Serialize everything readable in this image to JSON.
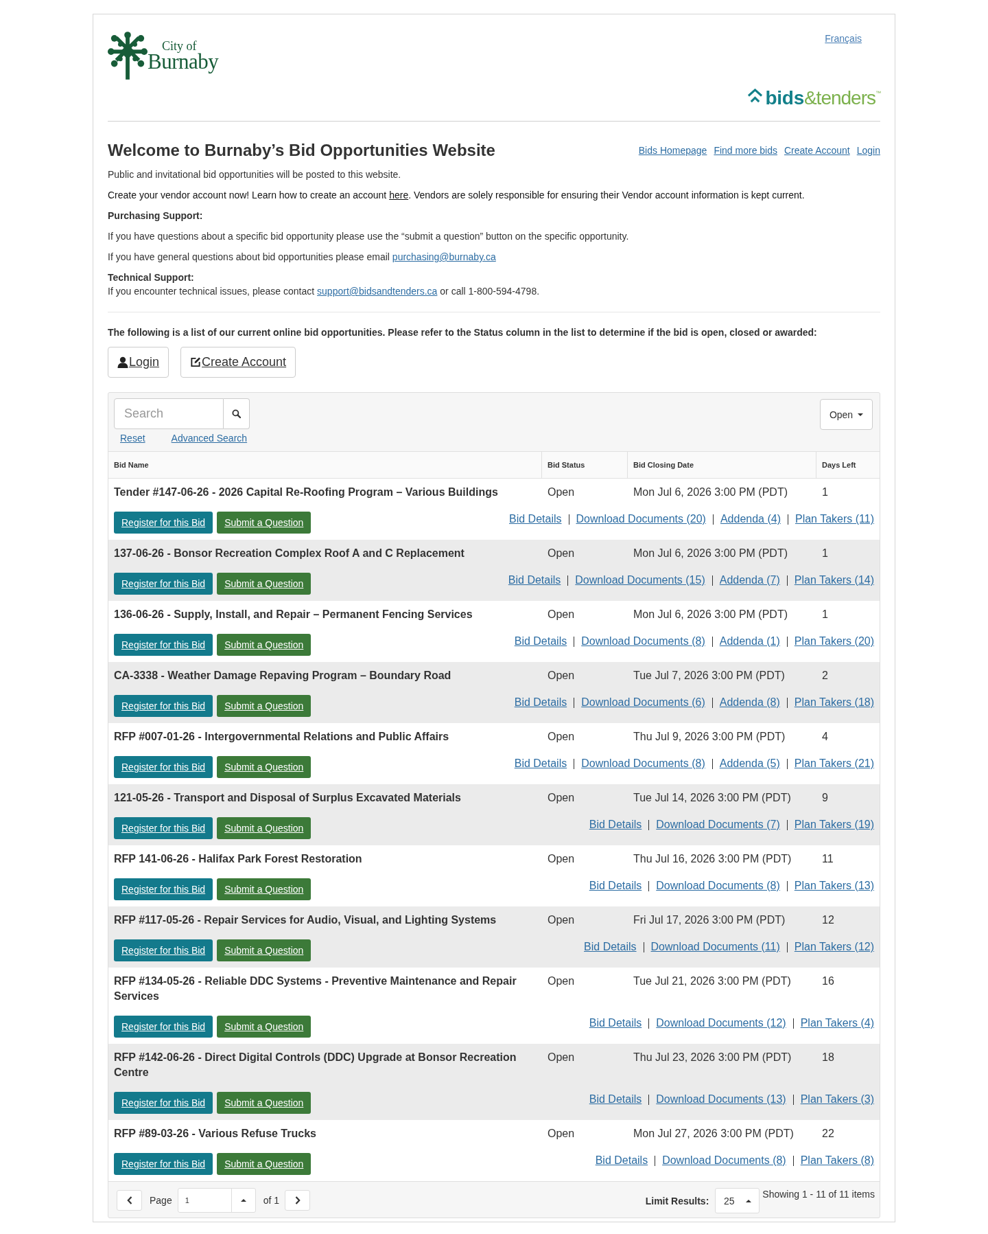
{
  "header": {
    "logo": {
      "line_1": "City of",
      "line_2": "Burnaby"
    },
    "language_link": "Français",
    "brand": "**bids**&tenders$^{™}$"
  },
  "intro": {
    "title": "Welcome to Burnaby’s Bid Opportunities Website",
    "nav_links": [
      "Bids Homepage",
      "Find more bids",
      "Create Account",
      "Login"
    ],
    "subtitle": "Public and invitational bid opportunities will be posted to this website.",
    "account_note": {
      "before": "Create your vendor account now! Learn how to create an account ",
      "link": "here",
      "after": ". Vendors are solely responsible for ensuring their Vendor account information is kept current."
    },
    "purchasing_support": {
      "heading": "Purchasing Support:",
      "lines": [
        {
          "text": "If you have questions about a specific bid opportunity please use the “submit a question” button on the specific opportunity."
        },
        {
          "text": "If you have general questions about bid opportunities please email ",
          "link": "purchasing@burnaby.ca"
        }
      ]
    },
    "technical_support": {
      "heading": "Technical Support:",
      "lines": [
        {
          "text": "If you encounter technical issues, please contact ",
          "link": "support@bidsandtenders.ca",
          "after": " or call 1-800-594-4798."
        }
      ]
    }
  },
  "list_intro": "The following is a list of our current online bid opportunities. Please refer to the Status column in the list to determine if the bid is open, closed or awarded:",
  "account_buttons": [
    {
      "kind": "login",
      "label": "Login"
    },
    {
      "kind": "create",
      "label": "Create Account"
    }
  ],
  "bid_list": {
    "search": {
      "placeholder": "Search"
    },
    "search_links": [
      "Reset",
      "Advanced Search"
    ],
    "status_filter": "Open",
    "columns": [
      "Bid Name",
      "Bid Status",
      "Bid Closing Date",
      "Days Left"
    ],
    "rows": [
      {
        "name": "Tender #147-06-26 - 2026 Capital Re-Roofing Program – Various Buildings",
        "status": "Open",
        "closing_date": "Mon Jul 6, 2026 3:00 PM (PDT)",
        "days_left": "1",
        "buttons": [
          {
            "kind": "register",
            "label": "Register for this Bid"
          },
          {
            "kind": "question",
            "label": "Submit a Question"
          }
        ],
        "links": [
          "Bid Details",
          "Download Documents (20)",
          "Addenda (4)",
          "Plan Takers (11)"
        ]
      },
      {
        "name": "137-06-26 - Bonsor Recreation Complex Roof A and C Replacement",
        "status": "Open",
        "closing_date": "Mon Jul 6, 2026 3:00 PM (PDT)",
        "days_left": "1",
        "buttons": [
          {
            "kind": "register",
            "label": "Register for this Bid"
          },
          {
            "kind": "question",
            "label": "Submit a Question"
          }
        ],
        "links": [
          "Bid Details",
          "Download Documents (15)",
          "Addenda (7)",
          "Plan Takers (14)"
        ]
      },
      {
        "name": "136-06-26 - Supply, Install, and Repair – Permanent Fencing Services",
        "status": "Open",
        "closing_date": "Mon Jul 6, 2026 3:00 PM (PDT)",
        "days_left": "1",
        "buttons": [
          {
            "kind": "register",
            "label": "Register for this Bid"
          },
          {
            "kind": "question",
            "label": "Submit a Question"
          }
        ],
        "links": [
          "Bid Details",
          "Download Documents (8)",
          "Addenda (1)",
          "Plan Takers (20)"
        ]
      },
      {
        "name": "CA-3338 - Weather Damage Repaving Program – Boundary Road",
        "status": "Open",
        "closing_date": "Tue Jul 7, 2026 3:00 PM (PDT)",
        "days_left": "2",
        "buttons": [
          {
            "kind": "register",
            "label": "Register for this Bid"
          },
          {
            "kind": "question",
            "label": "Submit a Question"
          }
        ],
        "links": [
          "Bid Details",
          "Download Documents (6)",
          "Addenda (8)",
          "Plan Takers (18)"
        ]
      },
      {
        "name": "RFP #007-01-26 - Intergovernmental Relations and Public Affairs",
        "status": "Open",
        "closing_date": "Thu Jul 9, 2026 3:00 PM (PDT)",
        "days_left": "4",
        "buttons": [
          {
            "kind": "register",
            "label": "Register for this Bid"
          },
          {
            "kind": "question",
            "label": "Submit a Question"
          }
        ],
        "links": [
          "Bid Details",
          "Download Documents (8)",
          "Addenda (5)",
          "Plan Takers (21)"
        ]
      },
      {
        "name": "121-05-26 - Transport and Disposal of Surplus Excavated Materials",
        "status": "Open",
        "closing_date": "Tue Jul 14, 2026 3:00 PM (PDT)",
        "days_left": "9",
        "buttons": [
          {
            "kind": "register",
            "label": "Register for this Bid"
          },
          {
            "kind": "question",
            "label": "Submit a Question"
          }
        ],
        "links": [
          "Bid Details",
          "Download Documents (7)",
          "Plan Takers (19)"
        ]
      },
      {
        "name": "RFP 141-06-26 - Halifax Park Forest Restoration",
        "status": "Open",
        "closing_date": "Thu Jul 16, 2026 3:00 PM (PDT)",
        "days_left": "11",
        "buttons": [
          {
            "kind": "register",
            "label": "Register for this Bid"
          },
          {
            "kind": "question",
            "label": "Submit a Question"
          }
        ],
        "links": [
          "Bid Details",
          "Download Documents (8)",
          "Plan Takers (13)"
        ]
      },
      {
        "name": "RFP #117-05-26 - Repair Services for Audio, Visual, and Lighting Systems",
        "status": "Open",
        "closing_date": "Fri Jul 17, 2026 3:00 PM (PDT)",
        "days_left": "12",
        "buttons": [
          {
            "kind": "register",
            "label": "Register for this Bid"
          },
          {
            "kind": "question",
            "label": "Submit a Question"
          }
        ],
        "links": [
          "Bid Details",
          "Download Documents (11)",
          "Plan Takers (12)"
        ]
      },
      {
        "name": "RFP #134-05-26 - Reliable DDC Systems - Preventive Maintenance and Repair Services",
        "status": "Open",
        "closing_date": "Tue Jul 21, 2026 3:00 PM (PDT)",
        "days_left": "16",
        "buttons": [
          {
            "kind": "register",
            "label": "Register for this Bid"
          },
          {
            "kind": "question",
            "label": "Submit a Question"
          }
        ],
        "links": [
          "Bid Details",
          "Download Documents (12)",
          "Plan Takers (4)"
        ]
      },
      {
        "name": "RFP #142-06-26 - Direct Digital Controls (DDC) Upgrade at Bonsor Recreation Centre",
        "status": "Open",
        "closing_date": "Thu Jul 23, 2026 3:00 PM (PDT)",
        "days_left": "18",
        "buttons": [
          {
            "kind": "register",
            "label": "Register for this Bid"
          },
          {
            "kind": "question",
            "label": "Submit a Question"
          }
        ],
        "links": [
          "Bid Details",
          "Download Documents (13)",
          "Plan Takers (3)"
        ]
      },
      {
        "name": "RFP #89-03-26 - Various Refuse Trucks",
        "status": "Open",
        "closing_date": "Mon Jul 27, 2026 3:00 PM (PDT)",
        "days_left": "22",
        "buttons": [
          {
            "kind": "register",
            "label": "Register for this Bid"
          },
          {
            "kind": "question",
            "label": "Submit a Question"
          }
        ],
        "links": [
          "Bid Details",
          "Download Documents (8)",
          "Plan Takers (8)"
        ]
      }
    ],
    "pagination": {
      "page_label": "Page",
      "page_value": "1",
      "of_label": "of 1",
      "limit_label": "Limit Results:",
      "limit_value": "25",
      "summary": "Showing 1 - 11 of 11 items"
    }
  }
}
